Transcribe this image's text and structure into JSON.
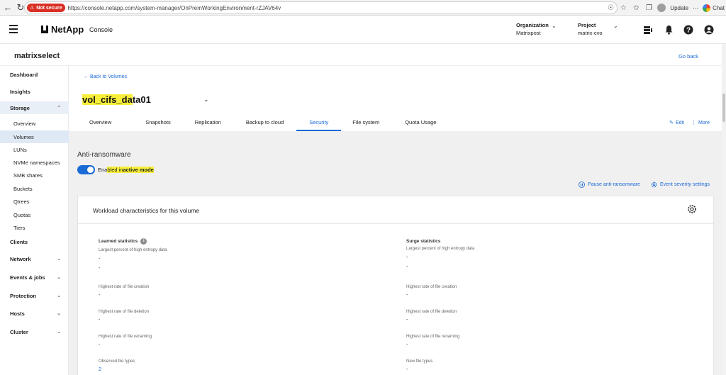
{
  "browser": {
    "not_secure": "Not secure",
    "url": "https://console.netapp.com/system-manager/OnPremWorkingEnvironment-rZJAV64v",
    "update_label": "Update",
    "chat_label": "Chat"
  },
  "header": {
    "brand": "NetApp",
    "app_name": "Console",
    "organization_title": "Organization",
    "organization_value": "Matrixpost",
    "project_title": "Project",
    "project_value": "matrix-cvo"
  },
  "subheader": {
    "workspace": "matrixselect",
    "go_back": "Go back"
  },
  "sidebar": {
    "items": [
      {
        "label": "Dashboard"
      },
      {
        "label": "Insights"
      },
      {
        "label": "Storage"
      },
      {
        "label": "Overview"
      },
      {
        "label": "Volumes"
      },
      {
        "label": "LUNs"
      },
      {
        "label": "NVMe namespaces"
      },
      {
        "label": "SMB shares"
      },
      {
        "label": "Buckets"
      },
      {
        "label": "Qtrees"
      },
      {
        "label": "Quotas"
      },
      {
        "label": "Tiers"
      },
      {
        "label": "Clients"
      },
      {
        "label": "Network"
      },
      {
        "label": "Events & jobs"
      },
      {
        "label": "Protection"
      },
      {
        "label": "Hosts"
      },
      {
        "label": "Cluster"
      }
    ]
  },
  "main": {
    "back_link": "Back to Volumes",
    "volume_name_highlight_1": "vol_cifs_da",
    "volume_name_rest": "ta01",
    "tabs": [
      {
        "label": "Overview"
      },
      {
        "label": "Snapshots"
      },
      {
        "label": "Replication"
      },
      {
        "label": "Backup to cloud"
      },
      {
        "label": "Security"
      },
      {
        "label": "File system"
      },
      {
        "label": "Quota Usage"
      }
    ],
    "edit_label": "Edit",
    "more_label": "More",
    "anti_ransomware_title": "Anti-ransomware",
    "toggle_prefix": "Ena",
    "toggle_highlight": "bled in ",
    "toggle_bold": "active mode",
    "pause_label": "Pause anti-ransomware",
    "severity_label": "Event severity settings",
    "card_title": "Workload characteristics for this volume",
    "learned": {
      "title": "Learned statistics",
      "entropy_label": "Largest percent of high entropy data",
      "entropy_value_1": "-",
      "entropy_value_2": "-",
      "creation_label": "Highest rate of file creation",
      "creation_value": "-",
      "deletion_label": "Highest rate of file deletion",
      "deletion_value": "-",
      "renaming_label": "Highest rate of file renaming",
      "renaming_value": "-",
      "types_label": "Observed file types",
      "types_value": "2"
    },
    "surge": {
      "title": "Surge statistics",
      "entropy_label": "Largest percent of high entropy data",
      "entropy_value_1": "-",
      "entropy_value_2": "-",
      "creation_label": "Highest rate of file creation",
      "creation_value": "-",
      "deletion_label": "Highest rate of file deletion",
      "deletion_value": "-",
      "renaming_label": "Highest rate of file renaming",
      "renaming_value": "-",
      "types_label": "New file types",
      "types_value": "-"
    }
  },
  "colors": {
    "accent": "#1a6bd6",
    "highlight": "#f7f03a",
    "not_secure": "#d93025"
  }
}
